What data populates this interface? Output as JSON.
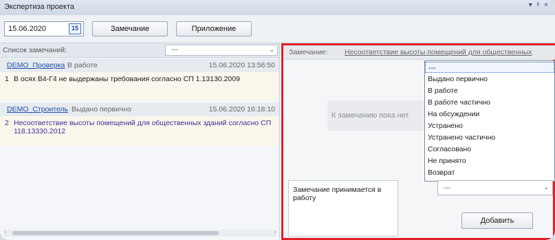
{
  "window": {
    "title": "Экспертиза проекта",
    "controls": "▾ ᵖ ×"
  },
  "toolbar": {
    "date": "15.06.2020",
    "calendar_day": "15",
    "remark_button": "Замечание",
    "attachment_button": "Приложение"
  },
  "left": {
    "list_label": "Список замечаний:",
    "filter_value": "---",
    "remarks": [
      {
        "author": "DEMO_Проверка",
        "status": "В работе",
        "time": "15.06.2020 13:56:50",
        "number": "1",
        "text": "В осях В4-Г4 не выдержаны требования согласно СП 1.13130.2009"
      },
      {
        "author": "DEMO_Строитель",
        "status": "Выдано первично",
        "time": "15.06.2020 16:18:10",
        "number": "2",
        "text": "Несоответствие высоты помещений для общественных зданий согласно СП 118.13330.2012"
      }
    ]
  },
  "right": {
    "remark_label": "Замечание:",
    "remark_link": "Несоответствие высоты помещений для общественных",
    "placeholder": "К замечанию пока нет",
    "status_options": [
      "---",
      "Выдано первично",
      "В работе",
      "В работе частично",
      "На обсуждении",
      "Устранено",
      "Устранено частично",
      "Согласовано",
      "Не принято",
      "Возврат"
    ],
    "comment_text": "Замечание принимается в работу",
    "status_value": "---",
    "add_button": "Добавить"
  },
  "colors": {
    "highlight": "#e01f26",
    "link": "#1f4fa8"
  }
}
